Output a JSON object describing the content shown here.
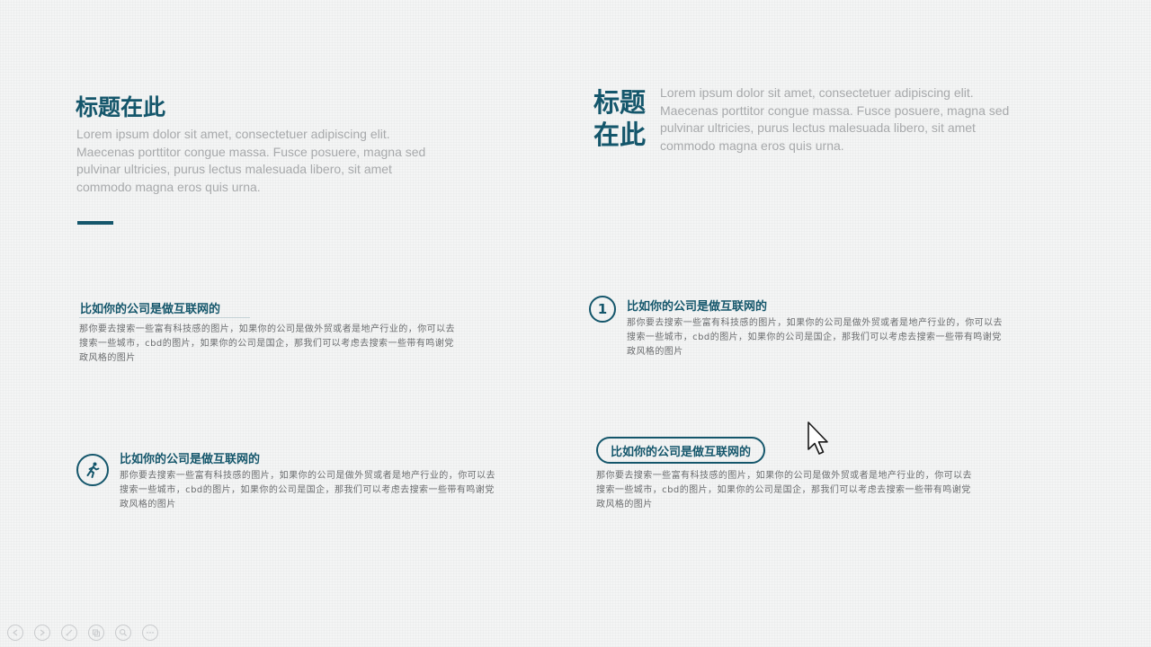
{
  "blocks": {
    "top_left": {
      "title": "标题在此",
      "body": "Lorem ipsum dolor sit amet, consectetuer adipiscing elit. Maecenas porttitor congue massa. Fusce posuere, magna sed pulvinar ultricies, purus lectus malesuada libero, sit amet commodo magna eros quis urna."
    },
    "top_right": {
      "title_line1": "标题",
      "title_line2": "在此",
      "body": "Lorem ipsum dolor sit amet, consectetuer adipiscing elit. Maecenas porttitor congue massa. Fusce posuere, magna sed pulvinar ultricies, purus lectus malesuada libero, sit amet commodo magna eros quis urna."
    },
    "mid_left": {
      "heading": "比如你的公司是做互联网的",
      "body": "那你要去搜索一些富有科技感的图片，如果你的公司是做外贸或者是地产行业的，你可以去搜索一些城市，cbd的图片，如果你的公司是国企，那我们可以考虑去搜索一些带有鸣谢党政风格的图片"
    },
    "mid_right": {
      "number": "1",
      "heading": "比如你的公司是做互联网的",
      "body": "那你要去搜索一些富有科技感的图片，如果你的公司是做外贸或者是地产行业的，你可以去搜索一些城市，cbd的图片，如果你的公司是国企，那我们可以考虑去搜索一些带有鸣谢党政风格的图片"
    },
    "bottom_left": {
      "icon": "runner-icon",
      "heading": "比如你的公司是做互联网的",
      "body": "那你要去搜索一些富有科技感的图片，如果你的公司是做外贸或者是地产行业的，你可以去搜索一些城市，cbd的图片，如果你的公司是国企，那我们可以考虑去搜索一些带有鸣谢党政风格的图片"
    },
    "bottom_right": {
      "heading": "比如你的公司是做互联网的",
      "body": "那你要去搜索一些富有科技感的图片，如果你的公司是做外贸或者是地产行业的，你可以去搜索一些城市，cbd的图片，如果你的公司是国企，那我们可以考虑去搜索一些带有鸣谢党政风格的图片"
    }
  },
  "theme": {
    "accent": "#14566b",
    "muted_text": "#a7a9ab",
    "body_text": "#6a6c6e",
    "background": "#f4f5f5"
  },
  "toolbar": {
    "buttons": [
      "prev-icon",
      "next-icon",
      "pen-icon",
      "slides-icon",
      "zoom-icon",
      "more-icon"
    ]
  }
}
